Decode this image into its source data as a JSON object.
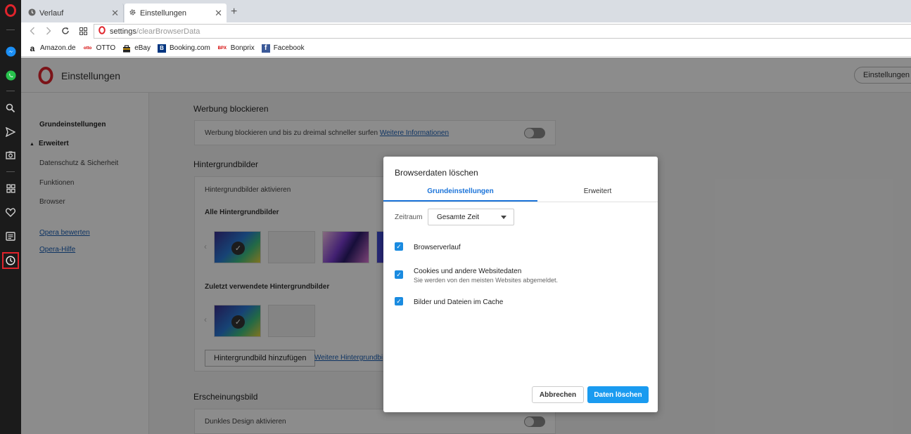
{
  "tabs": [
    {
      "label": "Verlauf",
      "icon": "clock-icon"
    },
    {
      "label": "Einstellungen",
      "icon": "gear-icon"
    }
  ],
  "tab_close": "✕",
  "new_tab": "+",
  "address": {
    "host": "settings",
    "path": "/clearBrowserData"
  },
  "bookmarks": [
    {
      "label": "Amazon.de"
    },
    {
      "label": "OTTO"
    },
    {
      "label": "eBay"
    },
    {
      "label": "Booking.com"
    },
    {
      "label": "Bonprix"
    },
    {
      "label": "Facebook"
    }
  ],
  "page": {
    "title": "Einstellungen",
    "header_button": "Einstellungen d",
    "nav": {
      "basic": "Grundeinstellungen",
      "advanced": "Erweitert",
      "privacy": "Datenschutz & Sicherheit",
      "features": "Funktionen",
      "browser": "Browser",
      "rate": "Opera bewerten",
      "help": "Opera-Hilfe"
    },
    "adblock": {
      "title": "Werbung blockieren",
      "text": "Werbung blockieren und bis zu dreimal schneller surfen",
      "link": "Weitere Informationen"
    },
    "wallpapers": {
      "title": "Hintergrundbilder",
      "enable": "Hintergrundbilder aktivieren",
      "all": "Alle Hintergrundbilder",
      "recent": "Zuletzt verwendete Hintergrundbilder",
      "add_button": "Hintergrundbild hinzufügen",
      "more_link": "Weitere Hintergrundbi"
    },
    "appearance": {
      "title": "Erscheinungsbild",
      "dark": "Dunkles Design aktivieren"
    }
  },
  "dialog": {
    "title": "Browserdaten löschen",
    "tab_basic": "Grundeinstellungen",
    "tab_advanced": "Erweitert",
    "range_label": "Zeitraum",
    "range_value": "Gesamte Zeit",
    "items": [
      {
        "label": "Browserverlauf",
        "checked": true
      },
      {
        "label": "Cookies und andere Websitedaten",
        "sub": "Sie werden von den meisten Websites abgemeldet.",
        "checked": true
      },
      {
        "label": "Bilder und Dateien im Cache",
        "checked": true
      }
    ],
    "cancel": "Abbrechen",
    "confirm": "Daten löschen"
  },
  "colors": {
    "accent": "#1a9bf0",
    "opera_red": "#e0242c",
    "sidebar_bg": "#1b1b1b"
  }
}
